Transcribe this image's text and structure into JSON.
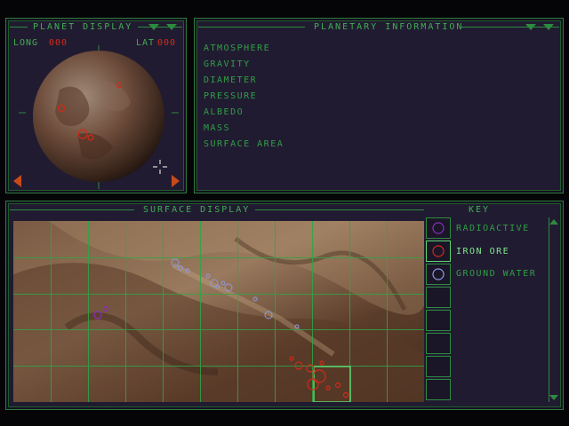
{
  "planet_display": {
    "title": "PLANET DISPLAY",
    "long_label": "LONG",
    "long_value": "000",
    "lat_label": "LAT",
    "lat_value": "000"
  },
  "planetary_info": {
    "title": "PLANETARY INFORMATION",
    "items": [
      "ATMOSPHERE",
      "GRAVITY",
      "DIAMETER",
      "PRESSURE",
      "ALBEDO",
      "MASS",
      "SURFACE AREA"
    ]
  },
  "surface_display": {
    "title": "SURFACE DISPLAY"
  },
  "key": {
    "title": "KEY",
    "items": [
      {
        "label": "RADIOACTIVE",
        "color": "#8a2fb8",
        "selected": false
      },
      {
        "label": "IRON ORE",
        "color": "#d22a1a",
        "selected": true
      },
      {
        "label": "GROUND WATER",
        "color": "#8f9ae0",
        "selected": false
      }
    ]
  },
  "colors": {
    "panel_bg": "#211b31",
    "border": "#2f7a3c",
    "text": "#3fae52",
    "value_red": "#d22a1a"
  }
}
